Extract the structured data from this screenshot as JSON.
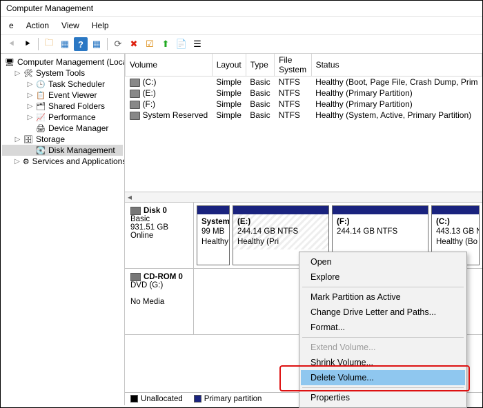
{
  "window": {
    "title": "Computer Management"
  },
  "menu": {
    "items": [
      "e",
      "Action",
      "View",
      "Help"
    ]
  },
  "toolbar": {
    "back": "⇐",
    "fwd": "⇒",
    "folder": "📁",
    "pane": "▥",
    "help": "?",
    "pane2": "▤",
    "refresh": "🗘",
    "x": "✖",
    "check": "✓",
    "props": "📄",
    "up": "⬆",
    "list": "☰",
    "detail": "☷"
  },
  "tree": {
    "root": "Computer Management (Local",
    "system_tools": "System Tools",
    "task_sched": "Task Scheduler",
    "event_viewer": "Event Viewer",
    "shared_folders": "Shared Folders",
    "performance": "Performance",
    "device_mgr": "Device Manager",
    "storage": "Storage",
    "disk_mgmt": "Disk Management",
    "services": "Services and Applications"
  },
  "columns": {
    "volume": "Volume",
    "layout": "Layout",
    "type": "Type",
    "fs": "File System",
    "status": "Status"
  },
  "volumes": [
    {
      "name": "(C:)",
      "layout": "Simple",
      "type": "Basic",
      "fs": "NTFS",
      "status": "Healthy (Boot, Page File, Crash Dump, Prim"
    },
    {
      "name": "(E:)",
      "layout": "Simple",
      "type": "Basic",
      "fs": "NTFS",
      "status": "Healthy (Primary Partition)"
    },
    {
      "name": "(F:)",
      "layout": "Simple",
      "type": "Basic",
      "fs": "NTFS",
      "status": "Healthy (Primary Partition)"
    },
    {
      "name": "System Reserved",
      "layout": "Simple",
      "type": "Basic",
      "fs": "NTFS",
      "status": "Healthy (System, Active, Primary Partition)"
    }
  ],
  "disk0": {
    "title": "Disk 0",
    "kind": "Basic",
    "size": "931.51 GB",
    "state": "Online",
    "parts": [
      {
        "label": "System",
        "size": "99 MB",
        "status": "Healthy"
      },
      {
        "label": "(E:)",
        "size": "244.14 GB NTFS",
        "status": "Healthy (Pri"
      },
      {
        "label": "(F:)",
        "size": "244.14 GB NTFS",
        "status": ""
      },
      {
        "label": "(C:)",
        "size": "443.13 GB N",
        "status": "Healthy (Bo"
      }
    ]
  },
  "cdrom": {
    "title": "CD-ROM 0",
    "kind": "DVD (G:)",
    "state": "No Media"
  },
  "legend": {
    "unalloc": "Unallocated",
    "primary": "Primary partition"
  },
  "context": {
    "open": "Open",
    "explore": "Explore",
    "mark_active": "Mark Partition as Active",
    "change_letter": "Change Drive Letter and Paths...",
    "format": "Format...",
    "extend": "Extend Volume...",
    "shrink": "Shrink Volume...",
    "delete": "Delete Volume...",
    "properties": "Properties"
  }
}
